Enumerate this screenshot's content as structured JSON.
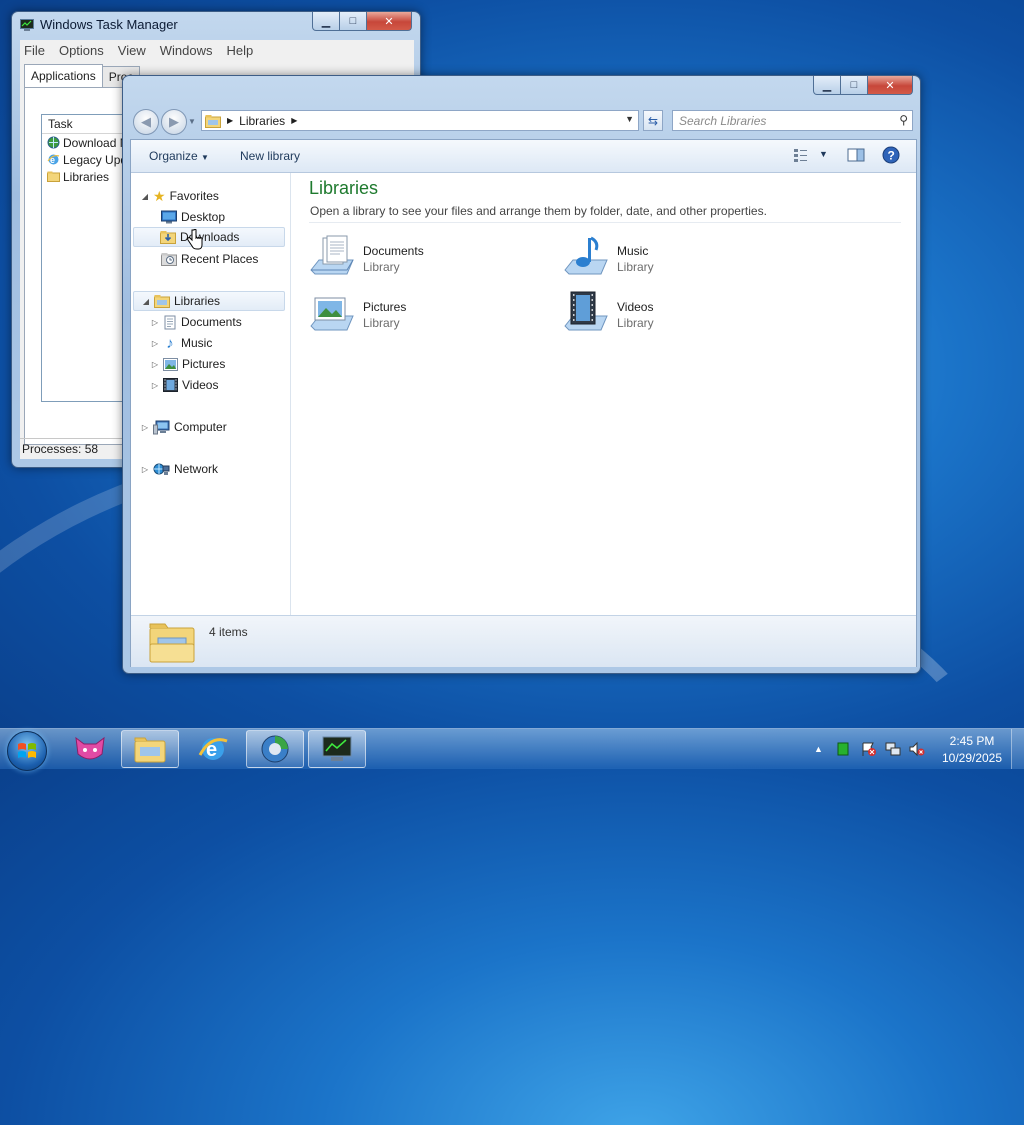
{
  "task_manager": {
    "title": "Windows Task Manager",
    "menu": [
      "File",
      "Options",
      "View",
      "Windows",
      "Help"
    ],
    "tabs": [
      "Applications",
      "Proc"
    ],
    "column_task": "Task",
    "tasks": [
      "Download M",
      "Legacy Upd",
      "Libraries"
    ],
    "status": "Processes: 58",
    "caption_buttons": {
      "min": "▁",
      "max": "□",
      "close": "✕"
    }
  },
  "explorer": {
    "address_parts": [
      "Libraries"
    ],
    "search_placeholder": "Search Libraries",
    "toolbar": {
      "organize": "Organize",
      "new_library": "New library"
    },
    "nav": {
      "favorites": "Favorites",
      "favorites_items": [
        "Desktop",
        "Downloads",
        "Recent Places"
      ],
      "libraries": "Libraries",
      "libraries_items": [
        "Documents",
        "Music",
        "Pictures",
        "Videos"
      ],
      "computer": "Computer",
      "network": "Network"
    },
    "content": {
      "title": "Libraries",
      "subtitle": "Open a library to see your files and arrange them by folder, date, and other properties.",
      "items": [
        {
          "name": "Documents",
          "type": "Library",
          "icon": "documents-library-icon"
        },
        {
          "name": "Music",
          "type": "Library",
          "icon": "music-library-icon"
        },
        {
          "name": "Pictures",
          "type": "Library",
          "icon": "pictures-library-icon"
        },
        {
          "name": "Videos",
          "type": "Library",
          "icon": "videos-library-icon"
        }
      ]
    },
    "details": {
      "count": "4 items"
    },
    "caption_buttons": {
      "min": "▁",
      "max": "□",
      "close": "✕"
    }
  },
  "taskbar": {
    "pinned": [
      "explorer",
      "internet-explorer",
      "browser",
      "task-manager"
    ],
    "clock": {
      "time": "2:45 PM",
      "date": "10/29/2025"
    }
  },
  "colors": {
    "library_title": "#1e7a2e",
    "taskbar": "#2f6fb5",
    "close_button": "#c7473a"
  }
}
